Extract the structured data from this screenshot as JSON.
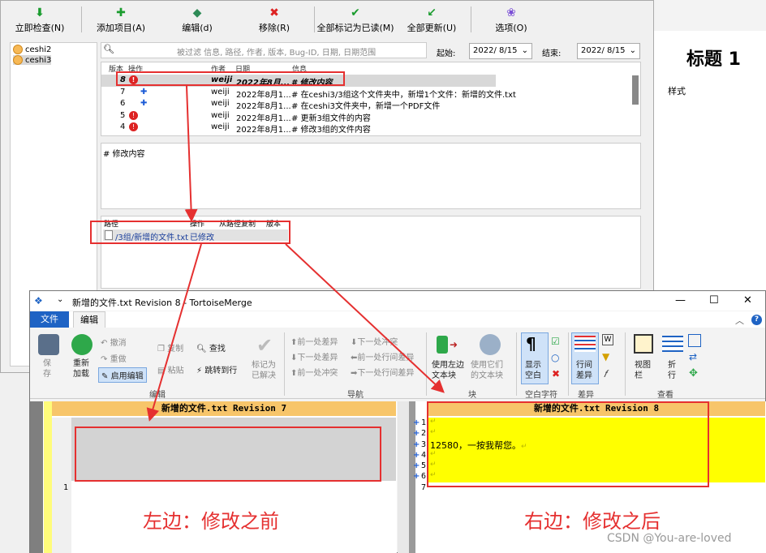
{
  "doc": {
    "heading": "标题 1",
    "style_label": "样式"
  },
  "log_toolbar": [
    {
      "label": "立即检查(N)",
      "icon": "down-arrow-icon",
      "color": "#1a9c2e"
    },
    {
      "label": "添加项目(A)",
      "icon": "plus-icon",
      "color": "#1a9c2e"
    },
    {
      "label": "编辑(d)",
      "icon": "edit-icon",
      "color": "#2e8b57"
    },
    {
      "label": "移除(R)",
      "icon": "remove-icon",
      "color": "#d22"
    },
    {
      "label": "全部标记为已读(M)",
      "icon": "check-icon",
      "color": "#1a9c2e"
    },
    {
      "label": "全部更新(U)",
      "icon": "update-icon",
      "color": "#1a9c2e"
    },
    {
      "label": "选项(O)",
      "icon": "options-icon",
      "color": "#7b4fd6"
    }
  ],
  "tree": [
    "ceshi2",
    "ceshi3"
  ],
  "filter": {
    "placeholder": "被过滤 信息, 路径, 作者, 版本, Bug-ID, 日期, 日期范围",
    "from_label": "起始:",
    "from_value": "2022/ 8/15",
    "to_label": "结束:",
    "to_value": "2022/ 8/15"
  },
  "log_columns": [
    "版本",
    "操作",
    "作者",
    "日期",
    "信息"
  ],
  "log_rows": [
    {
      "rev": "8",
      "action": "modified",
      "author": "weiji",
      "date": "2022年8月...",
      "msg": "# 修改内容",
      "selected": true
    },
    {
      "rev": "7",
      "action": "added",
      "author": "weiji",
      "date": "2022年8月1...",
      "msg": "# 在ceshi3/3组这个文件夹中，新增1个文件：新增的文件.txt"
    },
    {
      "rev": "6",
      "action": "added",
      "author": "weiji",
      "date": "2022年8月1...",
      "msg": "# 在ceshi3文件夹中，新增一个PDF文件"
    },
    {
      "rev": "5",
      "action": "modified",
      "author": "weiji",
      "date": "2022年8月1...",
      "msg": "# 更新3组文件的内容"
    },
    {
      "rev": "4",
      "action": "modified",
      "author": "weiji",
      "date": "2022年8月1...",
      "msg": "# 修改3组的文件内容"
    }
  ],
  "message": "# 修改内容",
  "path_columns": [
    "路径",
    "操作",
    "从路径复制",
    "版本"
  ],
  "path_row": {
    "path": "/3组/新增的文件.txt",
    "action": "已修改"
  },
  "merge": {
    "title": "新增的文件.txt Revision 8 - TortoiseMerge",
    "tabs": [
      "文件",
      "编辑"
    ],
    "edit_group": {
      "save": "保\n存",
      "reload": "重新\n加载",
      "undo": "撤消",
      "redo": "重做",
      "enable_edit": "启用编辑",
      "copy": "复制",
      "paste": "粘贴",
      "find": "查找",
      "goto": "跳转到行",
      "mark_resolved": "标记为\n已解决",
      "group": "编辑"
    },
    "nav_group": {
      "prev_diff": "前一处差异",
      "next_conflict": "下一处冲突",
      "next_diff": "下一处差异",
      "prev_inline": "前一处行间差异",
      "prev_conflict": "前一处冲突",
      "next_inline": "下一处行间差异",
      "group": "导航"
    },
    "block_group": {
      "use_left": "使用左边\n文本块",
      "use_both": "使用它们\n的文本块",
      "group": "块"
    },
    "ws_group": {
      "show_ws": "显示\n空白",
      "group": "空白字符"
    },
    "diff_group": {
      "inline": "行间\n差异",
      "group": "差异"
    },
    "view_group": {
      "view_bar": "视图\n栏",
      "wrap": "折\n行",
      "group": "查看"
    },
    "left_title": "新增的文件.txt Revision 7",
    "right_title": "新增的文件.txt Revision 8",
    "left_lines": [
      "1"
    ],
    "right_lines": [
      "1",
      "2",
      "3",
      "4",
      "5",
      "6",
      "7"
    ],
    "right_text": "12580，一按我帮您。"
  },
  "annotations": {
    "left": "左边：修改之前",
    "right": "右边：修改之后",
    "color": "#e53030"
  },
  "watermark": "CSDN @You-are-loved"
}
